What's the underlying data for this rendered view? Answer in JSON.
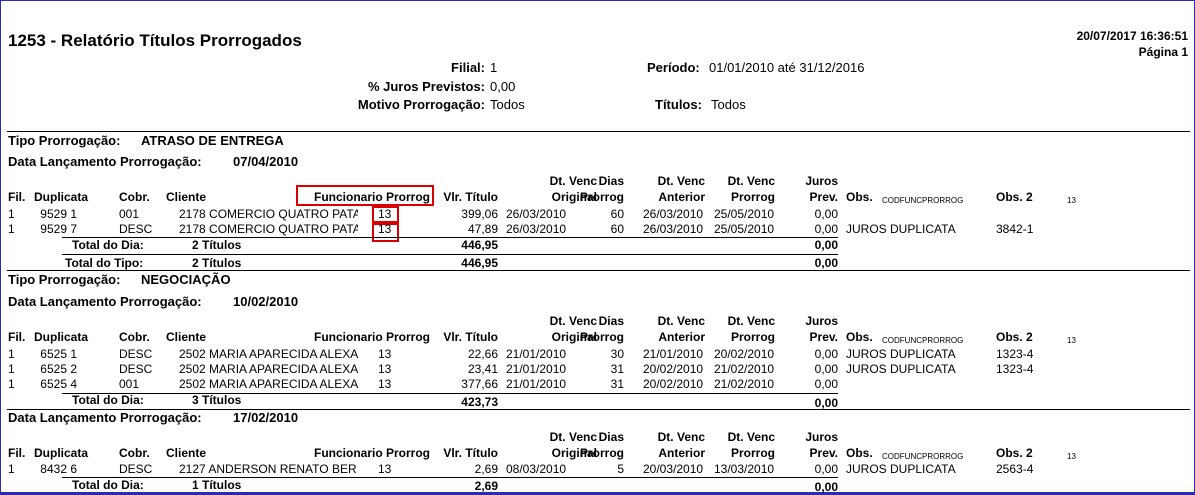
{
  "report": {
    "title": "1253 - Relatório Títulos Prorrogados",
    "datetime": "20/07/2017 16:36:51",
    "page": "Página 1"
  },
  "filters": {
    "filial_label": "Filial:",
    "filial_value": "1",
    "periodo_label": "Período:",
    "periodo_value": "01/01/2010 até 31/12/2016",
    "juros_label": "% Juros Previstos:",
    "juros_value": "0,00",
    "motivo_label": "Motivo Prorrogação:",
    "motivo_value": "Todos",
    "titulos_label": "Títulos:",
    "titulos_value": "Todos"
  },
  "columns": {
    "fil": "Fil.",
    "duplicata": "Duplicata",
    "cobr": "Cobr.",
    "cliente": "Cliente",
    "funcionario": "Funcionario Prorrog",
    "vlr": "Vlr. Título",
    "dtvenc_orig_1": "Dt. Venc",
    "dtvenc_orig_2": "Original",
    "dias_1": "Dias",
    "dias_2": "Prorrog",
    "dtvenc_ant_1": "Dt. Venc",
    "dtvenc_ant_2": "Anterior",
    "dtvenc_pror_1": "Dt. Venc",
    "dtvenc_pror_2": "Prorrog",
    "juros_1": "Juros",
    "juros_2": "Prev.",
    "obs": "Obs.",
    "codfunc": "CODFUNCPRORROG",
    "obs2": "Obs. 2",
    "extra": "13"
  },
  "labels": {
    "tipo": "Tipo Prorrogação:",
    "data_lanc": "Data Lançamento Prorrogação:",
    "total_dia": "Total do Dia:",
    "total_tipo": "Total do Tipo:"
  },
  "tipos": [
    {
      "name": "ATRASO DE ENTREGA",
      "date": "07/04/2010",
      "rows": [
        [
          "1",
          "9529 1",
          "001",
          "2178 COMERCIO QUATRO PATA",
          "13",
          "399,06",
          "26/03/2010",
          "60",
          "26/03/2010",
          "25/05/2010",
          "0,00",
          "",
          ""
        ],
        [
          "1",
          "9529 7",
          "DESC",
          "2178 COMERCIO QUATRO PATA",
          "13",
          "47,89",
          "26/03/2010",
          "60",
          "26/03/2010",
          "25/05/2010",
          "0,00",
          "JUROS DUPLICATA",
          "3842-1"
        ]
      ],
      "day_count": "2 Títulos",
      "day_value": "446,95",
      "day_juros": "0,00",
      "type_count": "2 Títulos",
      "type_value": "446,95",
      "type_juros": "0,00"
    },
    {
      "name": "NEGOCIAÇÃO",
      "groups": [
        {
          "date": "10/02/2010",
          "rows": [
            [
              "1",
              "6525 1",
              "DESC",
              "2502 MARIA APARECIDA ALEXAN",
              "13",
              "22,66",
              "21/01/2010",
              "30",
              "21/01/2010",
              "20/02/2010",
              "0,00",
              "JUROS DUPLICATA",
              "1323-4"
            ],
            [
              "1",
              "6525 2",
              "DESC",
              "2502 MARIA APARECIDA ALEXAN",
              "13",
              "23,41",
              "21/01/2010",
              "31",
              "20/02/2010",
              "21/02/2010",
              "0,00",
              "JUROS DUPLICATA",
              "1323-4"
            ],
            [
              "1",
              "6525 4",
              "001",
              "2502 MARIA APARECIDA ALEXAN",
              "13",
              "377,66",
              "21/01/2010",
              "31",
              "20/02/2010",
              "21/02/2010",
              "0,00",
              "",
              ""
            ]
          ],
          "day_count": "3 Títulos",
          "day_value": "423,73",
          "day_juros": "0,00"
        },
        {
          "date": "17/02/2010",
          "rows": [
            [
              "1",
              "8432 6",
              "DESC",
              "2127 ANDERSON RENATO BER",
              "13",
              "2,69",
              "08/03/2010",
              "5",
              "20/03/2010",
              "13/03/2010",
              "0,00",
              "JUROS DUPLICATA",
              "2563-4"
            ]
          ],
          "day_count": "1 Títulos",
          "day_value": "2,69",
          "day_juros": "0,00"
        }
      ]
    }
  ]
}
